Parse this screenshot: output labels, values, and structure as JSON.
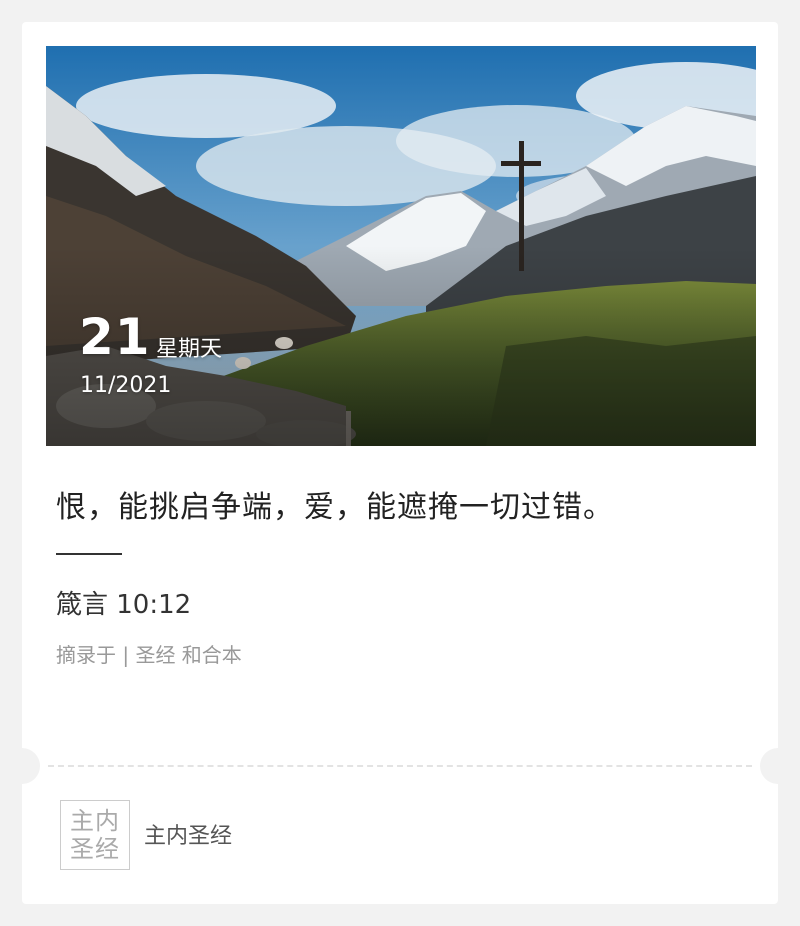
{
  "date": {
    "day": "21",
    "weekday": "星期天",
    "month_year": "11/2021"
  },
  "quote": {
    "text": "恨，能挑启争端，爱，能遮掩一切过错。",
    "reference": "箴言 10:12",
    "source": "摘录于 | 圣经 和合本"
  },
  "footer": {
    "logo_line1": "主内",
    "logo_line2": "圣经",
    "account_name": "主内圣经"
  },
  "colors": {
    "background": "#f2f2f2",
    "card": "#ffffff",
    "text_primary": "#222222",
    "text_muted": "#999999"
  }
}
